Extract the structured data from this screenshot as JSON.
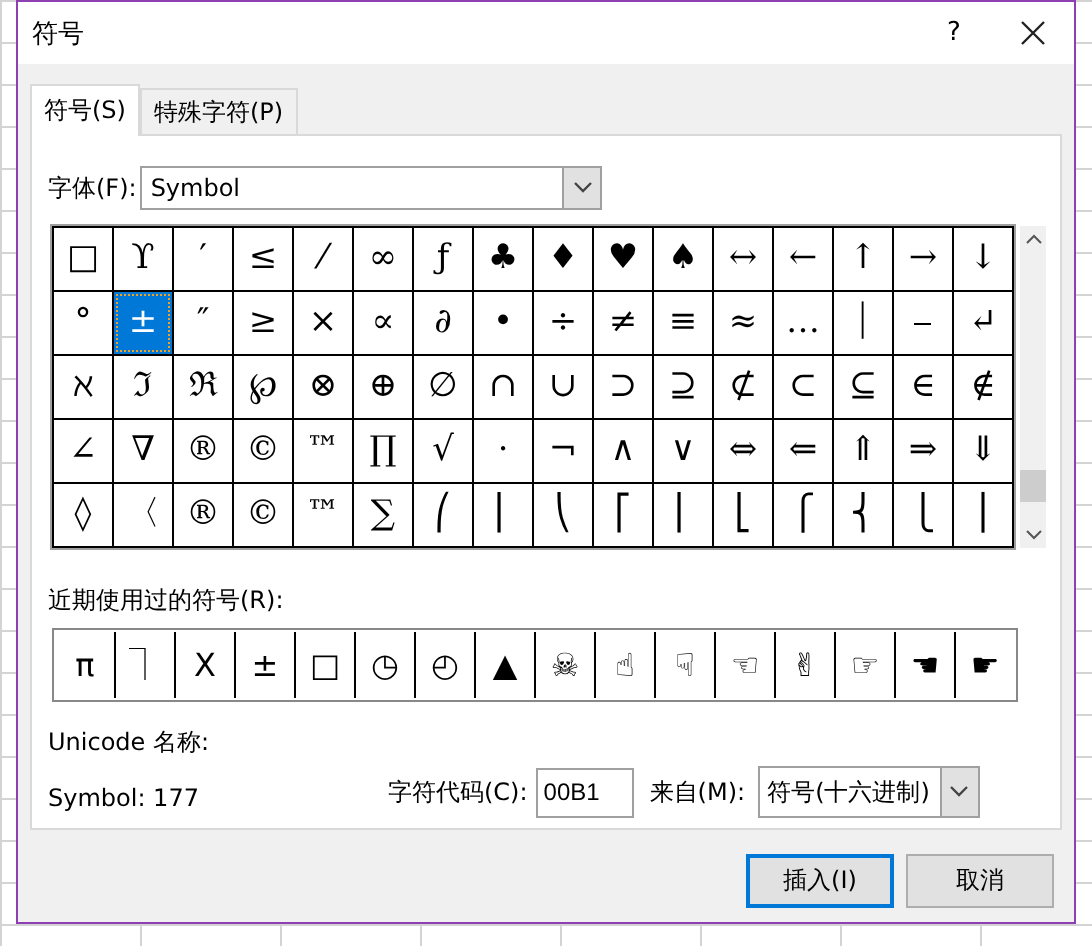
{
  "window": {
    "title": "符号",
    "help": "?"
  },
  "tabs": [
    {
      "label": "符号(S)",
      "selected": true
    },
    {
      "label": "特殊字符(P)",
      "selected": false
    }
  ],
  "font": {
    "label": "字体(F):",
    "value": "Symbol"
  },
  "symbols": [
    [
      {
        "c": "□",
        "selected": false
      },
      {
        "c": "ϒ",
        "selected": false
      },
      {
        "c": "′",
        "selected": false
      },
      {
        "c": "≤",
        "selected": false
      },
      {
        "c": "⁄",
        "selected": false
      },
      {
        "c": "∞",
        "selected": false
      },
      {
        "c": "ƒ",
        "selected": false
      },
      {
        "c": "♣",
        "selected": false
      },
      {
        "c": "♦",
        "selected": false
      },
      {
        "c": "♥",
        "selected": false
      },
      {
        "c": "♠",
        "selected": false
      },
      {
        "c": "↔",
        "selected": false
      },
      {
        "c": "←",
        "selected": false
      },
      {
        "c": "↑",
        "selected": false
      },
      {
        "c": "→",
        "selected": false
      },
      {
        "c": "↓",
        "selected": false
      }
    ],
    [
      {
        "c": "°",
        "selected": false
      },
      {
        "c": "±",
        "selected": true
      },
      {
        "c": "″",
        "selected": false
      },
      {
        "c": "≥",
        "selected": false
      },
      {
        "c": "×",
        "selected": false
      },
      {
        "c": "∝",
        "selected": false
      },
      {
        "c": "∂",
        "selected": false
      },
      {
        "c": "•",
        "selected": false
      },
      {
        "c": "÷",
        "selected": false
      },
      {
        "c": "≠",
        "selected": false
      },
      {
        "c": "≡",
        "selected": false
      },
      {
        "c": "≈",
        "selected": false
      },
      {
        "c": "…",
        "selected": false
      },
      {
        "c": "⏐",
        "selected": false
      },
      {
        "c": "⎯",
        "selected": false
      },
      {
        "c": "↵",
        "selected": false
      }
    ],
    [
      {
        "c": "ℵ",
        "selected": false
      },
      {
        "c": "ℑ",
        "selected": false
      },
      {
        "c": "ℜ",
        "selected": false
      },
      {
        "c": "℘",
        "selected": false
      },
      {
        "c": "⊗",
        "selected": false
      },
      {
        "c": "⊕",
        "selected": false
      },
      {
        "c": "∅",
        "selected": false
      },
      {
        "c": "∩",
        "selected": false
      },
      {
        "c": "∪",
        "selected": false
      },
      {
        "c": "⊃",
        "selected": false
      },
      {
        "c": "⊇",
        "selected": false
      },
      {
        "c": "⊄",
        "selected": false
      },
      {
        "c": "⊂",
        "selected": false
      },
      {
        "c": "⊆",
        "selected": false
      },
      {
        "c": "∈",
        "selected": false
      },
      {
        "c": "∉",
        "selected": false
      }
    ],
    [
      {
        "c": "∠",
        "selected": false
      },
      {
        "c": "∇",
        "selected": false
      },
      {
        "c": "®",
        "selected": false
      },
      {
        "c": "©",
        "selected": false
      },
      {
        "c": "™",
        "selected": false
      },
      {
        "c": "∏",
        "selected": false
      },
      {
        "c": "√",
        "selected": false
      },
      {
        "c": "⋅",
        "selected": false
      },
      {
        "c": "¬",
        "selected": false
      },
      {
        "c": "∧",
        "selected": false
      },
      {
        "c": "∨",
        "selected": false
      },
      {
        "c": "⇔",
        "selected": false
      },
      {
        "c": "⇐",
        "selected": false
      },
      {
        "c": "⇑",
        "selected": false
      },
      {
        "c": "⇒",
        "selected": false
      },
      {
        "c": "⇓",
        "selected": false
      }
    ],
    [
      {
        "c": "◊",
        "selected": false
      },
      {
        "c": "〈",
        "selected": false
      },
      {
        "c": "®",
        "selected": false
      },
      {
        "c": "©",
        "selected": false
      },
      {
        "c": "™",
        "selected": false
      },
      {
        "c": "∑",
        "selected": false
      },
      {
        "c": "⎛",
        "selected": false
      },
      {
        "c": "⎜",
        "selected": false
      },
      {
        "c": "⎝",
        "selected": false
      },
      {
        "c": "⎡",
        "selected": false
      },
      {
        "c": "⎢",
        "selected": false
      },
      {
        "c": "⎣",
        "selected": false
      },
      {
        "c": "⎧",
        "selected": false
      },
      {
        "c": "⎨",
        "selected": false
      },
      {
        "c": "⎩",
        "selected": false
      },
      {
        "c": "⎪",
        "selected": false
      }
    ]
  ],
  "recent": {
    "label": "近期使用过的符号(R):",
    "items": [
      "π",
      "⏋",
      "Χ",
      "±",
      "□",
      "◷",
      "◴",
      "▲",
      "☠",
      "☝",
      "☟",
      "☜",
      "✌",
      "☞",
      "☚",
      "☛"
    ]
  },
  "unicode_name": {
    "label": "Unicode 名称:",
    "value": "Symbol: 177"
  },
  "char_code": {
    "label": "字符代码(C):",
    "value": "00B1"
  },
  "from": {
    "label": "来自(M):",
    "value": "符号(十六进制)"
  },
  "buttons": [
    {
      "label": "插入(I)",
      "default": true
    },
    {
      "label": "取消",
      "default": false
    }
  ]
}
